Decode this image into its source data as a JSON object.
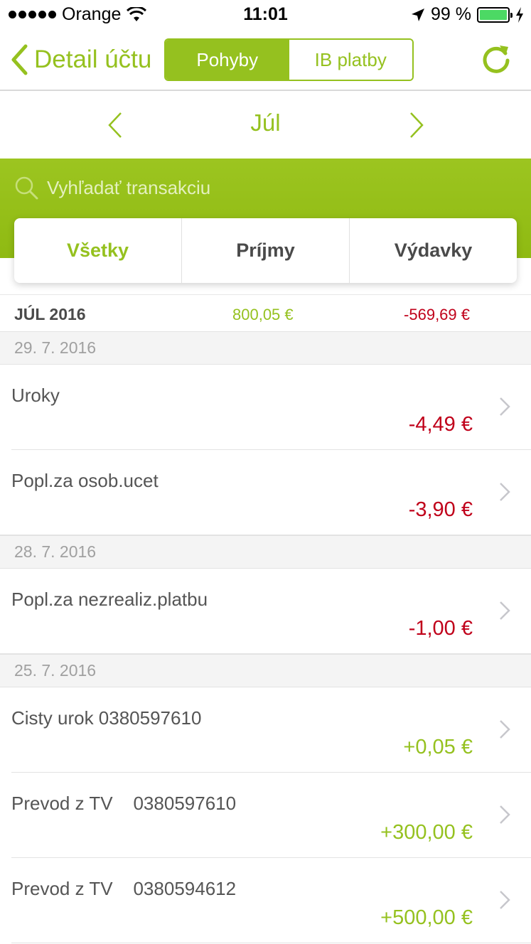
{
  "status_bar": {
    "carrier": "Orange",
    "time": "11:01",
    "battery": "99 %",
    "battery_level": 0.99
  },
  "nav": {
    "back_label": "Detail účtu",
    "tabs": [
      {
        "label": "Pohyby",
        "active": true
      },
      {
        "label": "IB platby",
        "active": false
      }
    ],
    "refresh_icon": "refresh-icon"
  },
  "month": {
    "label": "Júl"
  },
  "search": {
    "placeholder": "Vyhľadať transakciu"
  },
  "filters": [
    {
      "label": "Všetky",
      "active": true
    },
    {
      "label": "Príjmy",
      "active": false
    },
    {
      "label": "Výdavky",
      "active": false
    }
  ],
  "summary": {
    "label": "JÚL 2016",
    "income": "800,05 €",
    "expense": "-569,69 €"
  },
  "groups": [
    {
      "date": "29. 7. 2016",
      "items": [
        {
          "name": "Uroky",
          "amount": "-4,49 €",
          "sign": "neg"
        },
        {
          "name": "Popl.za osob.ucet",
          "amount": "-3,90 €",
          "sign": "neg"
        }
      ]
    },
    {
      "date": "28. 7. 2016",
      "items": [
        {
          "name": "Popl.za nezrealiz.platbu",
          "amount": "-1,00 €",
          "sign": "neg"
        }
      ]
    },
    {
      "date": "25. 7. 2016",
      "items": [
        {
          "name": "Cisty urok 0380597610",
          "amount": "+0,05 €",
          "sign": "pos"
        },
        {
          "name": "Prevod z TV    0380597610",
          "amount": "+300,00 €",
          "sign": "pos"
        },
        {
          "name": "Prevod z TV    0380594612",
          "amount": "+500,00 €",
          "sign": "pos"
        }
      ]
    }
  ],
  "colors": {
    "accent": "#95c11f",
    "negative": "#c0001a"
  }
}
